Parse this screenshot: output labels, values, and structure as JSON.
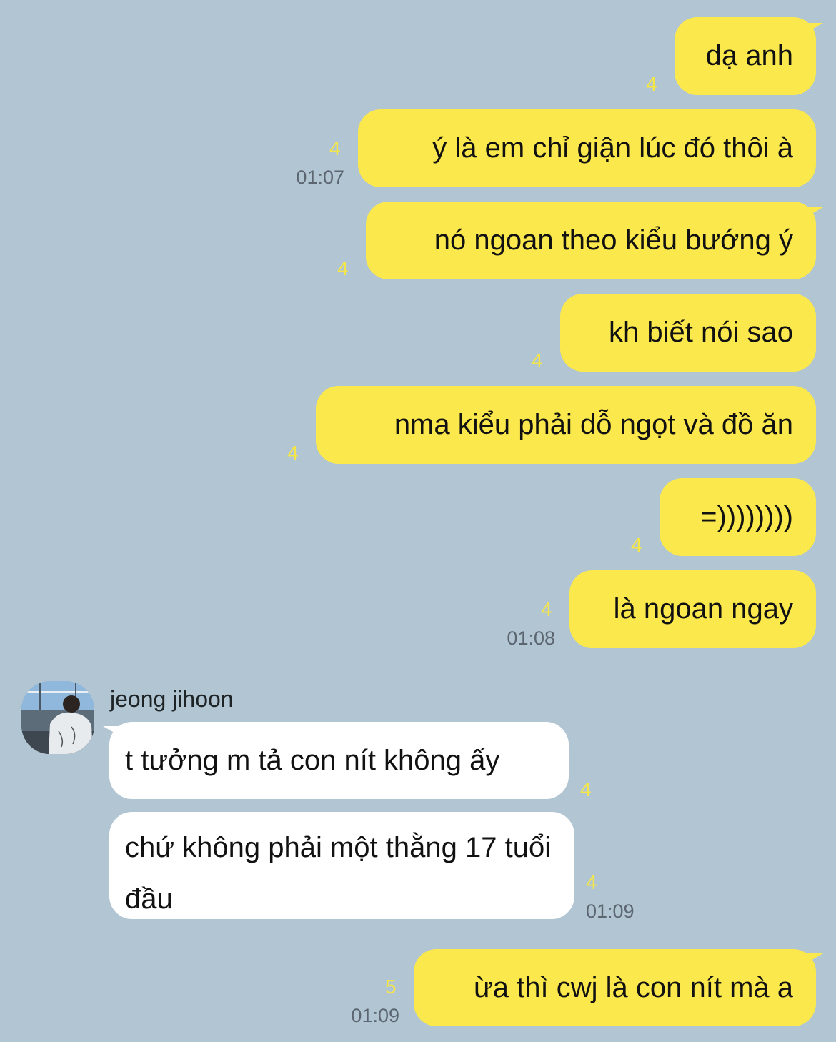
{
  "chat": {
    "contact_name": "jeong jihoon",
    "messages": [
      {
        "text": "dạ anh",
        "count": "4",
        "time": ""
      },
      {
        "text": "ý là em chỉ giận lúc đó thôi à",
        "count": "4",
        "time": "01:07"
      },
      {
        "text": "nó ngoan theo kiểu bướng ý",
        "count": "4",
        "time": ""
      },
      {
        "text": "kh biết nói sao",
        "count": "4",
        "time": ""
      },
      {
        "text": "nma kiểu phải dỗ ngọt và đồ ăn",
        "count": "4",
        "time": ""
      },
      {
        "text": "=))))))))",
        "count": "4",
        "time": ""
      },
      {
        "text": "là ngoan ngay",
        "count": "4",
        "time": "01:08"
      },
      {
        "text": "t tưởng m tả con nít không ấy",
        "count": "4",
        "time": ""
      },
      {
        "text": "chứ không phải một thằng 17 tuổi đầu",
        "count": "4",
        "time": "01:09"
      },
      {
        "text": "ừa thì cwj là con nít mà a",
        "count": "5",
        "time": "01:09"
      }
    ]
  },
  "colors": {
    "background": "#b2c5d3",
    "outgoing_bubble": "#fbe84c",
    "incoming_bubble": "#ffffff",
    "unread_count": "#f3e54a",
    "timestamp": "#5c6670"
  },
  "icons": {
    "avatar": "profile-photo"
  }
}
